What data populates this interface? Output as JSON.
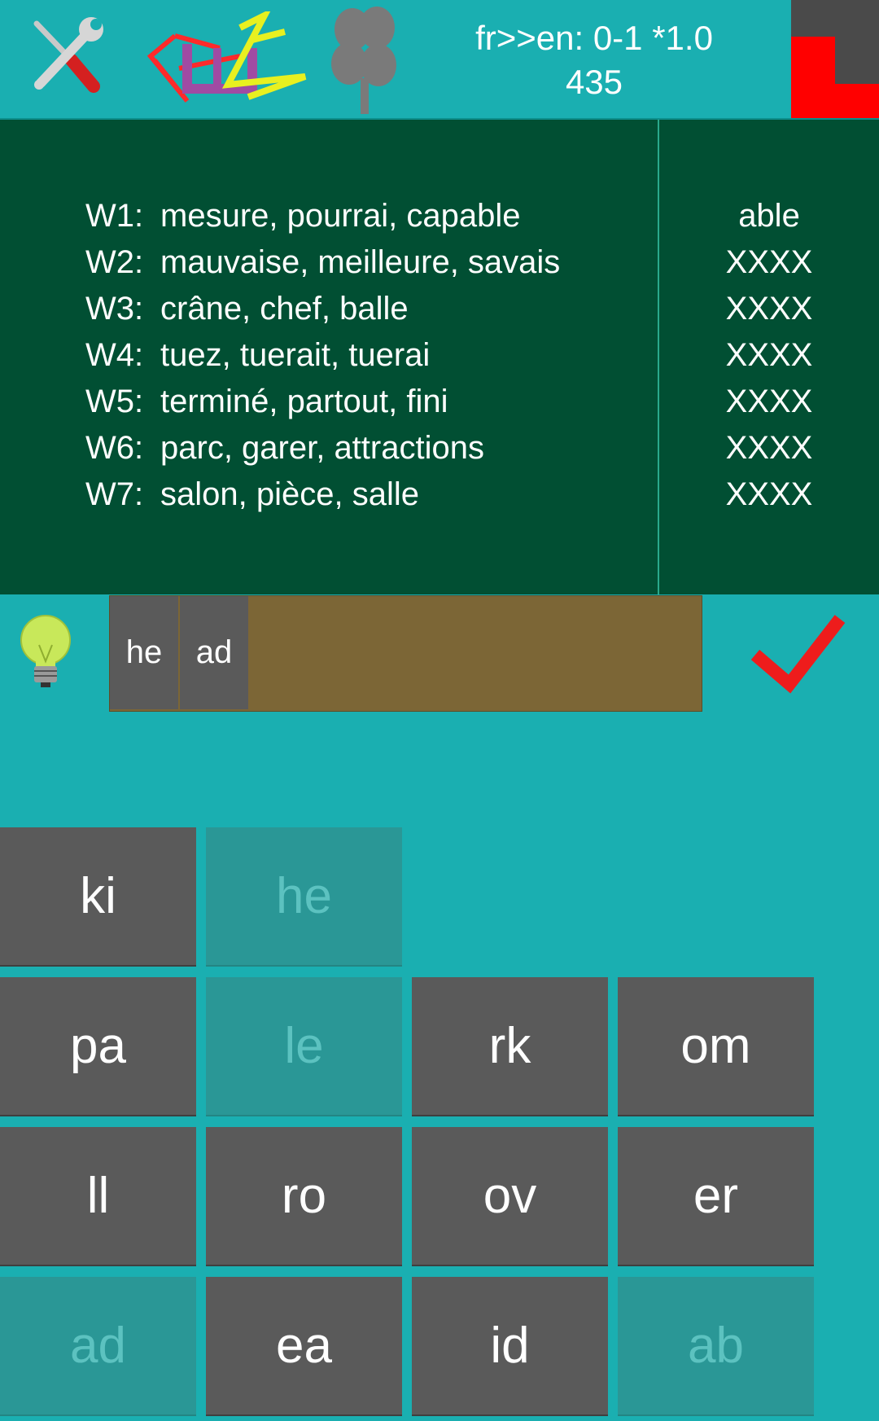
{
  "header": {
    "status_line1": "fr>>en: 0-1 *1.0",
    "status_line2": "435",
    "icons": [
      "settings-tools-icon",
      "scribble-logo-icon",
      "clover-icon"
    ],
    "corner_colors": {
      "dark": "#4a4a4a",
      "red": "#ff0000"
    }
  },
  "clues": [
    {
      "label": "W1:",
      "words": "mesure, pourrai, capable",
      "answer": "able"
    },
    {
      "label": "W2:",
      "words": "mauvaise, meilleure, savais",
      "answer": "XXXX"
    },
    {
      "label": "W3:",
      "words": "crâne, chef, balle",
      "answer": "XXXX"
    },
    {
      "label": "W4:",
      "words": "tuez, tuerait, tuerai",
      "answer": "XXXX"
    },
    {
      "label": "W5:",
      "words": "terminé, partout, fini",
      "answer": "XXXX"
    },
    {
      "label": "W6:",
      "words": "parc, garer, attractions",
      "answer": "XXXX"
    },
    {
      "label": "W7:",
      "words": "salon, pièce, salle",
      "answer": "XXXX"
    }
  ],
  "entry": {
    "chips": [
      "he",
      "ad"
    ],
    "hint_icon": "lightbulb-icon",
    "submit_icon": "checkmark-icon"
  },
  "keys": [
    {
      "label": "ki",
      "used": false
    },
    {
      "label": "he",
      "used": true
    },
    {
      "label": "pa",
      "used": false
    },
    {
      "label": "le",
      "used": true
    },
    {
      "label": "rk",
      "used": false
    },
    {
      "label": "om",
      "used": false
    },
    {
      "label": "ll",
      "used": false
    },
    {
      "label": "ro",
      "used": false
    },
    {
      "label": "ov",
      "used": false
    },
    {
      "label": "er",
      "used": false
    },
    {
      "label": "ad",
      "used": true
    },
    {
      "label": "ea",
      "used": false
    },
    {
      "label": "id",
      "used": false
    },
    {
      "label": "ab",
      "used": true
    }
  ],
  "colors": {
    "background": "#1aafb1",
    "panel": "#014f33",
    "key": "#5a5a5a",
    "key_used": "#2a9796",
    "entry": "#7c6636",
    "accent": "#ff0000"
  }
}
